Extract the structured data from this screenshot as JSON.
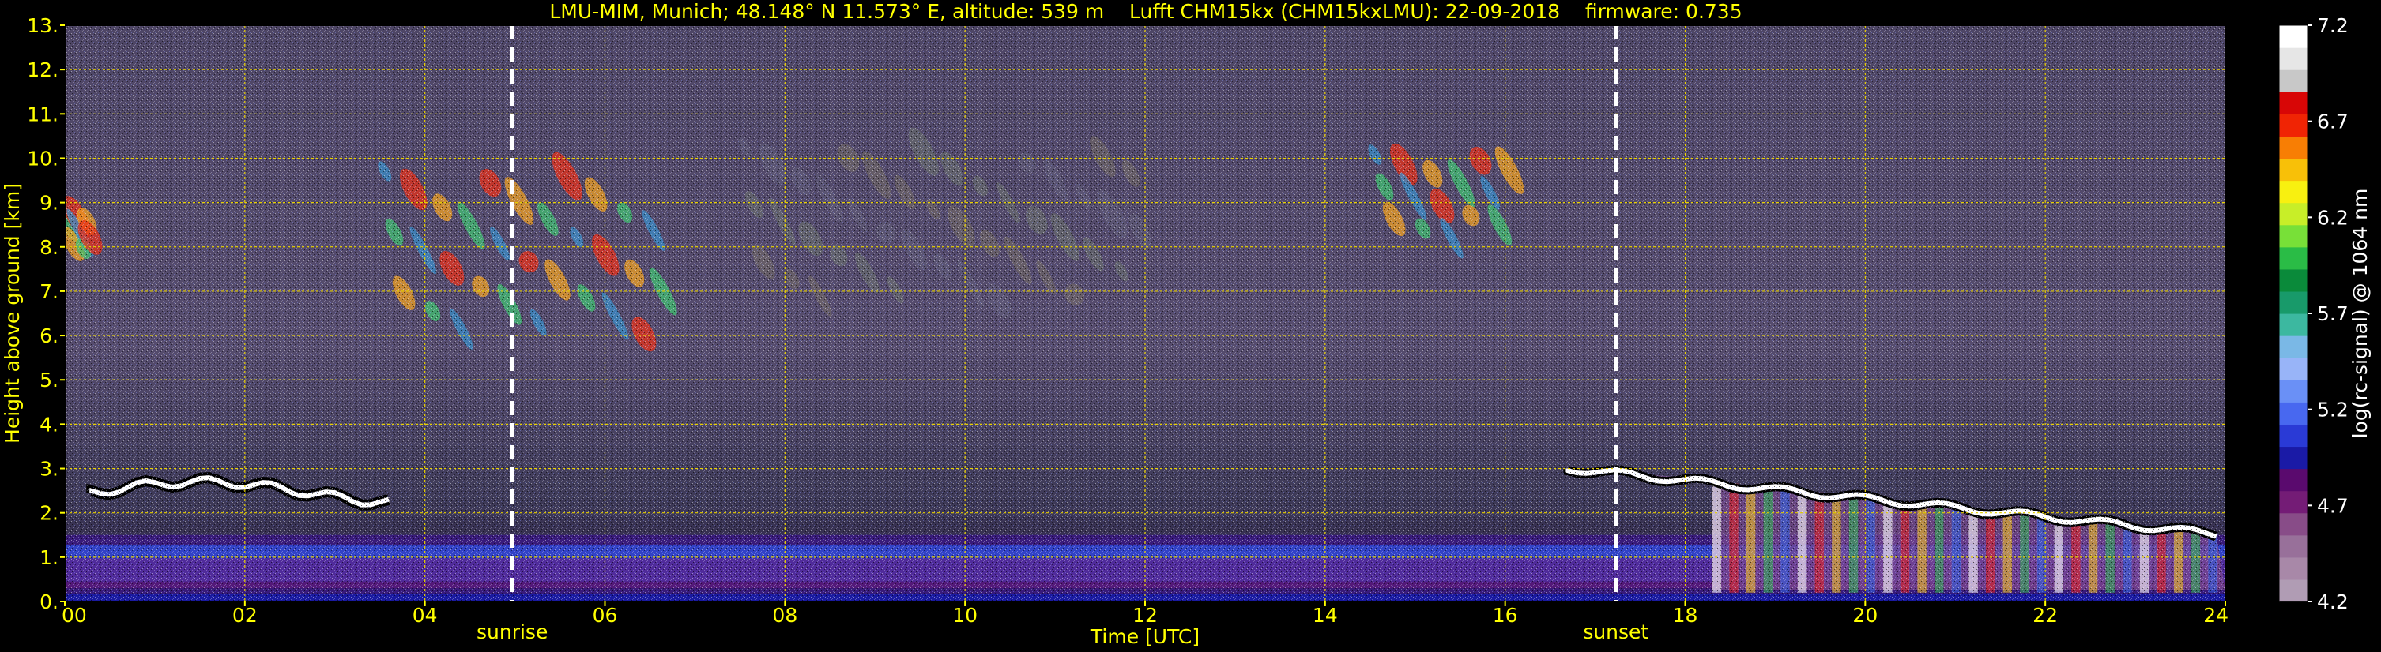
{
  "chart_data": {
    "type": "heatmap",
    "title": "LMU-MIM, Munich; 48.148° N 11.573° E, altitude: 539 m    Lufft CHM15kx (CHM15kxLMU): 22-09-2018    firmware: 0.735",
    "xlabel": "Time [UTC]",
    "ylabel": "Height above ground [km]",
    "xlim": [
      0,
      24
    ],
    "ylim": [
      0,
      13
    ],
    "x_ticks": [
      "00",
      "02",
      "04",
      "06",
      "08",
      "10",
      "12",
      "14",
      "16",
      "18",
      "20",
      "22",
      "24"
    ],
    "y_ticks": [
      "0.",
      "1.",
      "2.",
      "3.",
      "4.",
      "5.",
      "6.",
      "7.",
      "8.",
      "9.",
      "10.",
      "11.",
      "12.",
      "13."
    ],
    "grid": true,
    "annotations": [
      {
        "label": "sunrise",
        "time": 4.97
      },
      {
        "label": "sunset",
        "time": 17.23
      }
    ],
    "colorbar": {
      "label": "log(rc-signal) @ 1064 nm",
      "range": [
        4.2,
        7.2
      ],
      "ticks": [
        "7.2",
        "6.7",
        "6.2",
        "5.7",
        "5.2",
        "4.7",
        "4.2"
      ],
      "colors": [
        "#b09cb4",
        "#a888a8",
        "#98709a",
        "#884c88",
        "#741c76",
        "#5a0a6e",
        "#1a1aa6",
        "#2a3ad6",
        "#4868f0",
        "#6a90f6",
        "#98b4f8",
        "#7ab8e6",
        "#3cb8a0",
        "#189a6a",
        "#0a8a3a",
        "#2abc46",
        "#78e038",
        "#c8ee28",
        "#f8f010",
        "#f8c008",
        "#f87e04",
        "#f02404",
        "#d80606",
        "#c8c8c8",
        "#e6e6e6",
        "#ffffff"
      ]
    },
    "features": [
      {
        "kind": "cirrus",
        "t_start": 3.5,
        "t_end": 6.7,
        "h_bottom": 5.2,
        "h_top": 10.5
      },
      {
        "kind": "cirrus",
        "t_start": 0.0,
        "t_end": 0.3,
        "h_bottom": 7.6,
        "h_top": 9.0
      },
      {
        "kind": "thin cirrus",
        "t_start": 7.5,
        "t_end": 12.0,
        "h_bottom": 6.0,
        "h_top": 11.0
      },
      {
        "kind": "cirrus",
        "t_start": 14.5,
        "t_end": 16.1,
        "h_bottom": 7.7,
        "h_top": 10.5
      },
      {
        "kind": "boundary layer",
        "t_start": 0.0,
        "t_end": 24.0,
        "h_bottom": 0.0,
        "h_top": 1.5
      },
      {
        "kind": "residual layer top",
        "t_start": 0.3,
        "t_end": 3.7,
        "h_bottom": 2.3,
        "h_top": 2.8
      },
      {
        "kind": "low cloud layer",
        "t_start": 16.7,
        "t_end": 24.0,
        "h_bottom": 1.3,
        "h_top": 3.0
      }
    ]
  }
}
